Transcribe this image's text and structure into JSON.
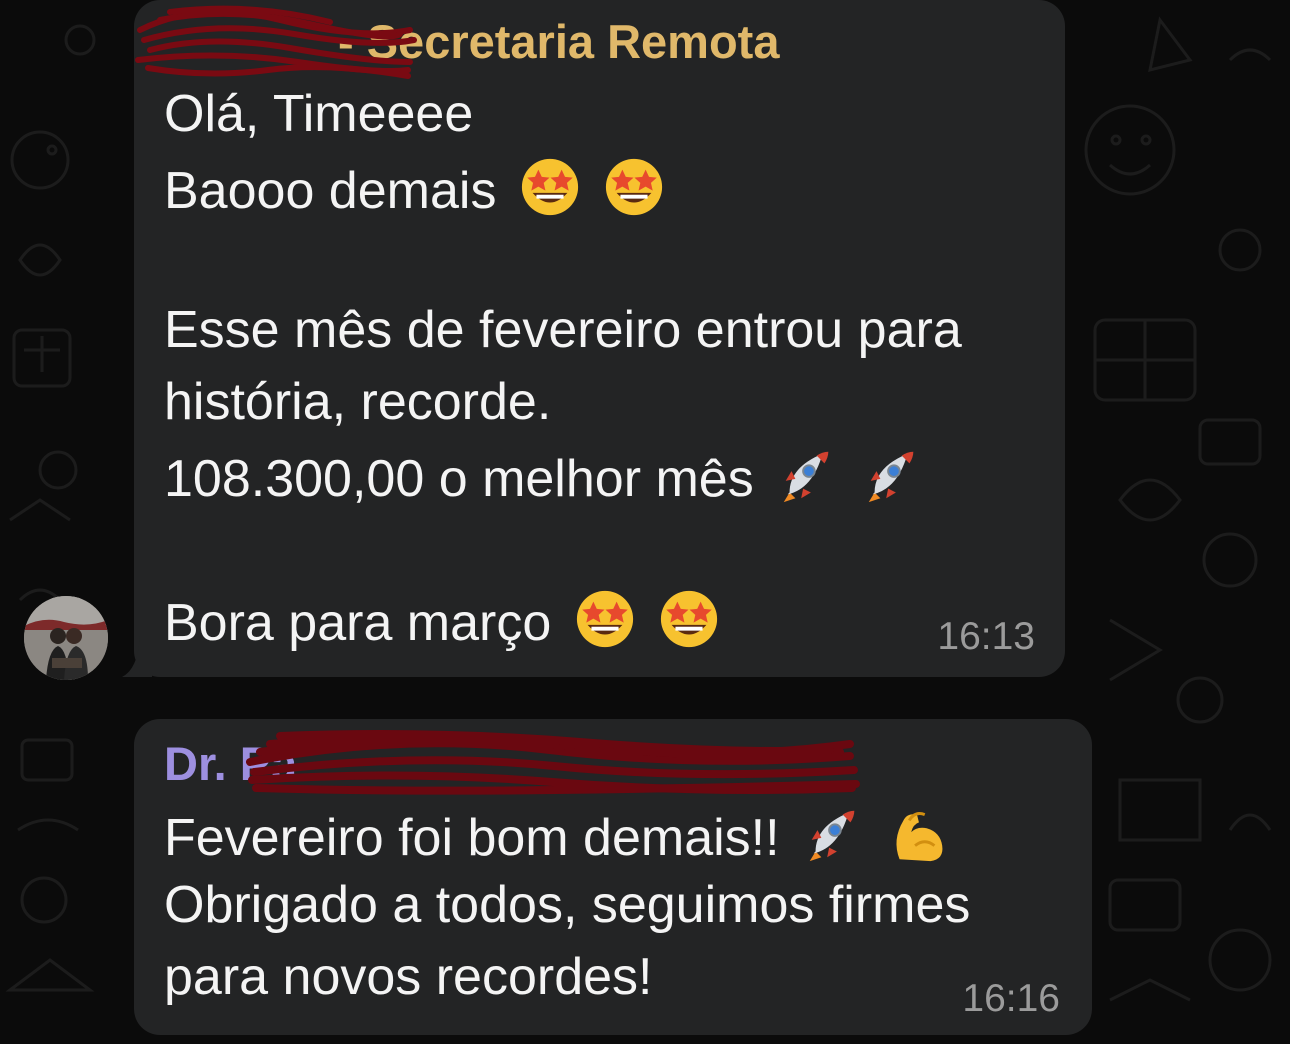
{
  "chat": {
    "messages": [
      {
        "sender": "- Secretaria Remota",
        "lines": [
          "Olá, Timeeee",
          "Baooo demais",
          "Esse mês de fevereiro entrou para",
          "história, recorde.",
          "108.300,00 o melhor mês",
          "Bora para março"
        ],
        "time": "16:13",
        "avatar": "avatar"
      },
      {
        "sender": "Dr. Pa",
        "lines": [
          "Fevereiro foi bom demais!!",
          "Obrigado a todos, seguimos firmes",
          "para novos recordes!"
        ],
        "time": "16:16"
      }
    ]
  },
  "icons": {
    "star_struck": "star-struck-icon",
    "rocket": "rocket-icon",
    "flexed_biceps": "flexed-biceps-icon"
  },
  "colors": {
    "background": "#0b0b0b",
    "bubble": "#232425",
    "sender_1": "#e0b86a",
    "sender_2": "#9d8fe0",
    "text": "#f4f4f4",
    "time": "#9b9b9b",
    "redaction": "#7a0a12"
  }
}
